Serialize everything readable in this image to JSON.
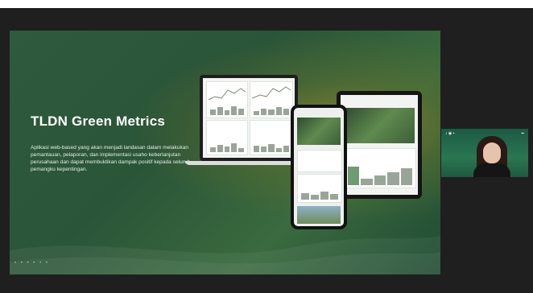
{
  "slide": {
    "title": "TLDN Green Metrics",
    "description": "Aplikasi web-based yang akan menjadi landasan dalam melakukan pemantauan, pelaporan, dan implementasi usaho keberlanjutan perusahaan dan dapat membuktikan dampak positif kepada seluruh pemangku kepentingan.",
    "footer": "• • • • • •"
  },
  "participant": {
    "header_left": "♪ ◉ ▪",
    "header_right": "▪▪"
  },
  "colors": {
    "slide_green": "#2b5538",
    "accent_gold": "#be9628",
    "background": "#1f1f1f"
  }
}
